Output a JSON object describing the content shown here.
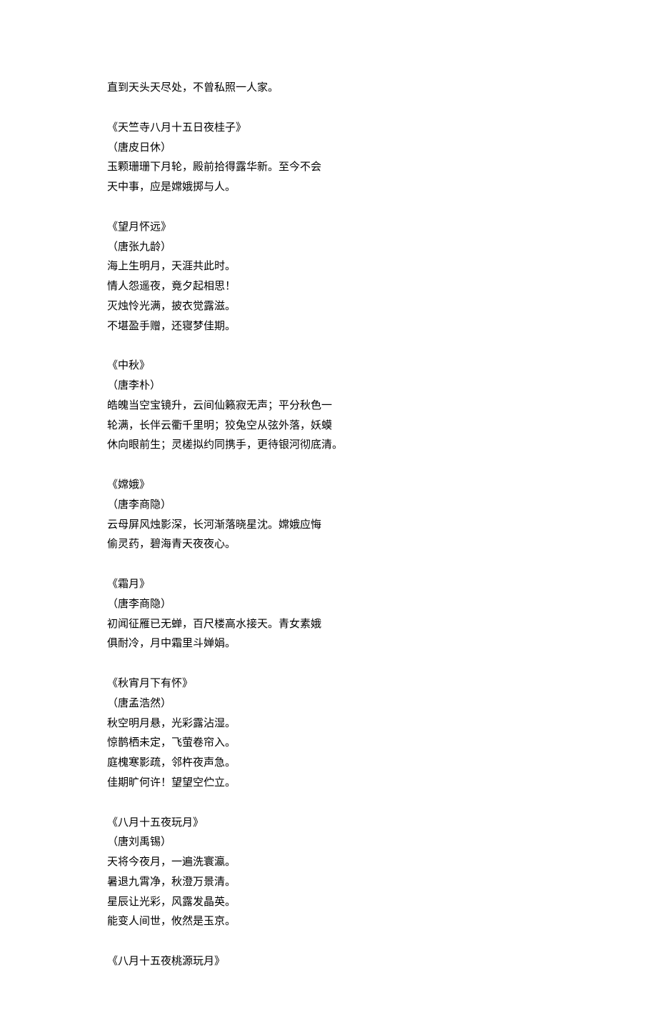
{
  "prelude_line": "直到天头天尽处，不曾私照一人家。",
  "poems": [
    {
      "title": "《天竺寺八月十五日夜桂子》",
      "author": "（唐皮日休）",
      "lines": [
        "玉颗珊珊下月轮，殿前拾得露华新。至今不会",
        "天中事，应是嫦娥掷与人。"
      ]
    },
    {
      "title": "《望月怀远》",
      "author": "（唐张九龄）",
      "lines": [
        "海上生明月，天涯共此时。",
        "情人怨遥夜，竟夕起相思！",
        "灭烛怜光满，披衣觉露滋。",
        "不堪盈手赠，还寝梦佳期。"
      ]
    },
    {
      "title": "《中秋》",
      "author": "（唐李朴）",
      "lines": [
        "皓魄当空宝镜升，云间仙籁寂无声；平分秋色一",
        "轮满，长伴云衢千里明；狡兔空从弦外落，妖蟆",
        "休向眼前生；灵槎拟约同携手，更待银河彻底清。"
      ]
    },
    {
      "title": "《嫦娥》",
      "author": "（唐李商隐）",
      "lines": [
        "云母屏风烛影深，长河渐落晓星沈。嫦娥应悔",
        "偷灵药，碧海青天夜夜心。"
      ]
    },
    {
      "title": "《霜月》",
      "author": "（唐李商隐）",
      "lines": [
        "初闻征雁已无蝉，百尺楼高水接天。青女素娥",
        "俱耐冷，月中霜里斗婵娟。"
      ]
    },
    {
      "title": "《秋宵月下有怀》",
      "author": "（唐孟浩然）",
      "lines": [
        "秋空明月悬，光彩露沾湿。",
        "惊鹊栖未定，飞萤卷帘入。",
        "庭槐寒影疏，邻杵夜声急。",
        "佳期旷何许！望望空伫立。"
      ]
    },
    {
      "title": "《八月十五夜玩月》",
      "author": "（唐刘禹锡）",
      "lines": [
        "天将今夜月，一遍洗寰瀛。",
        "暑退九霄净，秋澄万景清。",
        "星辰让光彩，风露发晶英。",
        "能变人间世，攸然是玉京。"
      ]
    },
    {
      "title": "《八月十五夜桃源玩月》",
      "author": "",
      "lines": []
    }
  ]
}
